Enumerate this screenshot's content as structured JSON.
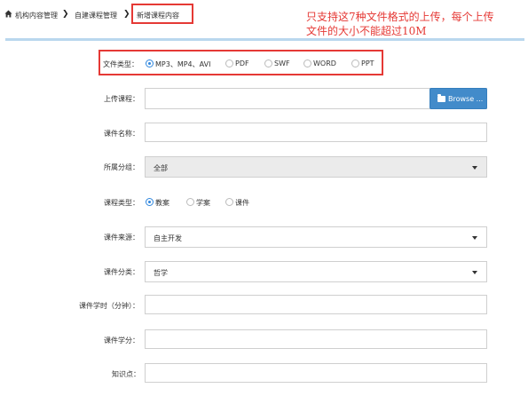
{
  "breadcrumb": {
    "item1": "机构内容管理",
    "item2": "自建课程管理",
    "current": "新增课程内容"
  },
  "annotation": {
    "line1": "只支持这7种文件格式的上传，每个上传",
    "line2": "文件的大小不能超过10M"
  },
  "form": {
    "file_type": {
      "label": "文件类型：",
      "options": [
        "MP3、MP4、AVI",
        "PDF",
        "SWF",
        "WORD",
        "PPT"
      ],
      "selected": "MP3、MP4、AVI"
    },
    "upload": {
      "label": "上传课程：",
      "value": "",
      "browse_label": "Browse ..."
    },
    "courseware_name": {
      "label": "课件名称：",
      "value": ""
    },
    "group": {
      "label": "所属分组：",
      "value": "全部"
    },
    "course_type": {
      "label": "课程类型：",
      "options": [
        "教案",
        "学案",
        "课件"
      ],
      "selected": "教案"
    },
    "source": {
      "label": "课件来源：",
      "value": "自主开发"
    },
    "category": {
      "label": "课件分类：",
      "value": "哲学"
    },
    "hours": {
      "label": "课件学时（分钟）：",
      "value": ""
    },
    "credits": {
      "label": "课件学分：",
      "value": ""
    },
    "knowledge": {
      "label": "知识点：",
      "value": ""
    }
  },
  "colors": {
    "accent": "#2e86de",
    "annotation": "#e53935",
    "button": "#428bca",
    "panel_top": "#b9d7ee"
  },
  "icons": {
    "home": "home-icon",
    "separator": "chevron-right-icon",
    "browse": "folder-open-icon",
    "select": "caret-down-icon"
  }
}
